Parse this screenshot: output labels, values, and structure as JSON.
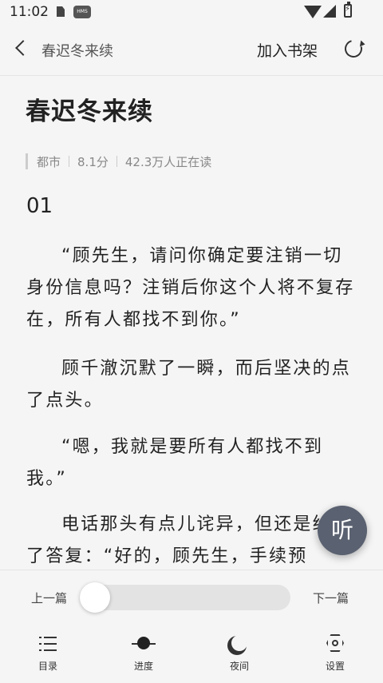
{
  "status_bar": {
    "time": "11:02",
    "hms_badge": "HMS"
  },
  "nav": {
    "title": "春迟冬来续",
    "add_shelf": "加入书架"
  },
  "book": {
    "title": "春迟冬来续",
    "category": "都市",
    "score": "8.1分",
    "readers": "42.3万人正在读",
    "chapter": "01",
    "paragraphs": [
      "“顾先生，请问你确定要注销一切身份信息吗？注销后你这个人将不复存在，所有人都找不到你。”",
      "顾千澈沉默了一瞬，而后坚决的点了点头。",
      "“嗯，我就是要所有人都找不到我。”",
      "电话那头有点儿诧异，但还是给出了答复：“好的，顾先生，手续预"
    ]
  },
  "listen_button": "听",
  "reader_controls": {
    "prev_chapter": "上一篇",
    "next_chapter": "下一篇",
    "progress_fraction": 0.0,
    "tabs": [
      {
        "label": "目录",
        "icon": "list-icon"
      },
      {
        "label": "进度",
        "icon": "progress-icon"
      },
      {
        "label": "夜间",
        "icon": "moon-icon"
      },
      {
        "label": "设置",
        "icon": "gear-icon"
      }
    ]
  }
}
